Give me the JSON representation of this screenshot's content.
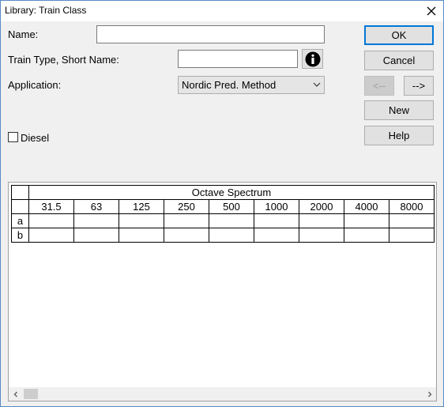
{
  "window": {
    "title": "Library: Train Class"
  },
  "form": {
    "name_label": "Name:",
    "name_value": "",
    "short_name_label": "Train Type, Short Name:",
    "short_name_value": "",
    "application_label": "Application:",
    "application_value": "Nordic Pred. Method",
    "diesel_label": "Diesel",
    "diesel_checked": false
  },
  "buttons": {
    "ok": "OK",
    "cancel": "Cancel",
    "prev": "<--",
    "next": "-->",
    "new": "New",
    "help": "Help"
  },
  "icons": {
    "info": "info-icon",
    "close": "close-icon",
    "dropdown": "chevron-down-icon",
    "scroll_left": "scroll-left-arrow-icon",
    "scroll_right": "scroll-right-arrow-icon"
  },
  "table": {
    "group_header": "Octave Spectrum",
    "columns": [
      "31.5",
      "63",
      "125",
      "250",
      "500",
      "1000",
      "2000",
      "4000",
      "8000"
    ],
    "rows": [
      {
        "label": "a",
        "values": [
          "",
          "",
          "",
          "",
          "",
          "",
          "",
          "",
          ""
        ]
      },
      {
        "label": "b",
        "values": [
          "",
          "",
          "",
          "",
          "",
          "",
          "",
          "",
          ""
        ]
      }
    ]
  }
}
